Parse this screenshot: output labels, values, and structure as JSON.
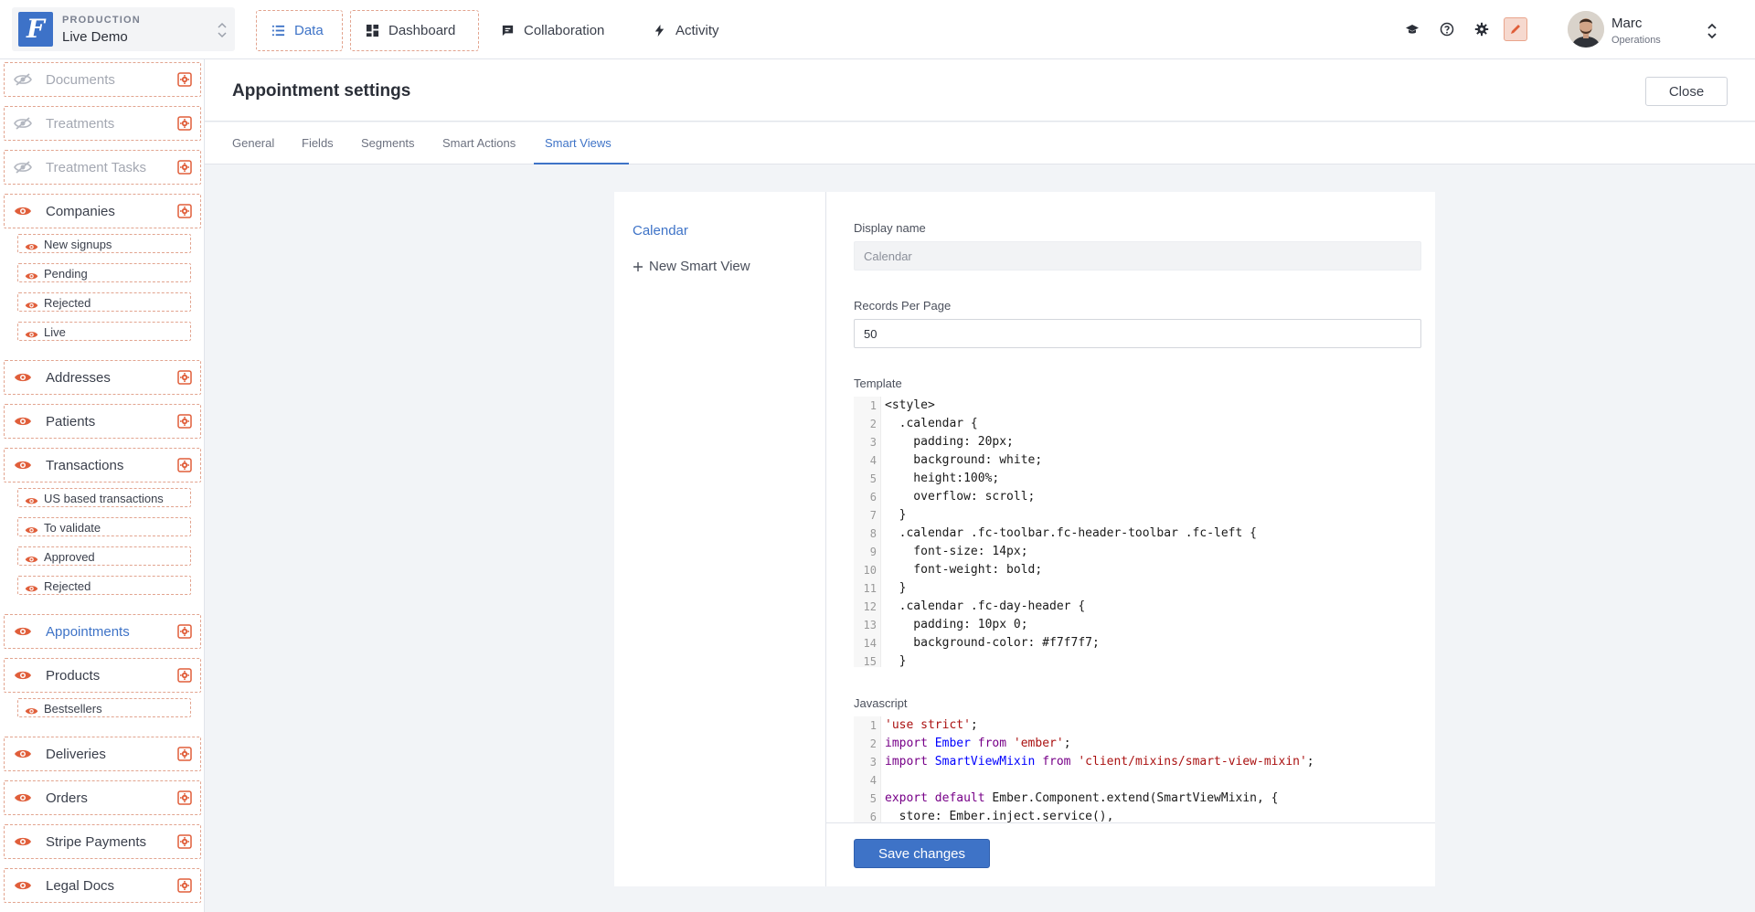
{
  "project": {
    "environment": "PRODUCTION",
    "name": "Live Demo"
  },
  "nav": {
    "tabs": [
      {
        "label": "Data",
        "icon": "list-icon"
      },
      {
        "label": "Dashboard",
        "icon": "dashboard-icon"
      },
      {
        "label": "Collaboration",
        "icon": "chat-icon"
      },
      {
        "label": "Activity",
        "icon": "bolt-icon"
      }
    ],
    "active_tab": "Data"
  },
  "user": {
    "name": "Marc",
    "role": "Operations"
  },
  "colors": {
    "accent": "#3e73c7",
    "orange": "#e05e3a",
    "dashed": "#e2a48f"
  },
  "sidebar": {
    "collections": [
      {
        "label": "Documents",
        "hidden": true
      },
      {
        "label": "Treatments",
        "hidden": true
      },
      {
        "label": "Treatment Tasks",
        "hidden": true
      },
      {
        "label": "Companies",
        "segments": [
          "New signups",
          "Pending",
          "Rejected",
          "Live"
        ]
      },
      {
        "label": "Addresses"
      },
      {
        "label": "Patients"
      },
      {
        "label": "Transactions",
        "segments": [
          "US based transactions",
          "To validate",
          "Approved",
          "Rejected"
        ]
      },
      {
        "label": "Appointments",
        "active": true
      },
      {
        "label": "Products",
        "segments": [
          "Bestsellers"
        ]
      },
      {
        "label": "Deliveries"
      },
      {
        "label": "Orders"
      },
      {
        "label": "Stripe Payments"
      },
      {
        "label": "Legal Docs"
      }
    ]
  },
  "settings": {
    "title": "Appointment settings",
    "close_label": "Close",
    "tabs": [
      "General",
      "Fields",
      "Segments",
      "Smart Actions",
      "Smart Views"
    ],
    "active_tab": "Smart Views",
    "views": {
      "items": [
        "Calendar"
      ],
      "new_label": "New Smart View"
    },
    "form": {
      "display_name_label": "Display name",
      "display_name_value": "Calendar",
      "records_label": "Records Per Page",
      "records_value": "50",
      "template_label": "Template",
      "template_lines": [
        "<style>",
        "  .calendar {",
        "    padding: 20px;",
        "    background: white;",
        "    height:100%;",
        "    overflow: scroll;",
        "  }",
        "  .calendar .fc-toolbar.fc-header-toolbar .fc-left {",
        "    font-size: 14px;",
        "    font-weight: bold;",
        "  }",
        "  .calendar .fc-day-header {",
        "    padding: 10px 0;",
        "    background-color: #f7f7f7;",
        "  }"
      ],
      "javascript_label": "Javascript",
      "javascript_lines": [
        "'use strict';",
        "import Ember from 'ember';",
        "import SmartViewMixin from 'client/mixins/smart-view-mixin';",
        "",
        "export default Ember.Component.extend(SmartViewMixin, {",
        "  store: Ember.inject.service(),"
      ],
      "save_label": "Save changes"
    }
  }
}
